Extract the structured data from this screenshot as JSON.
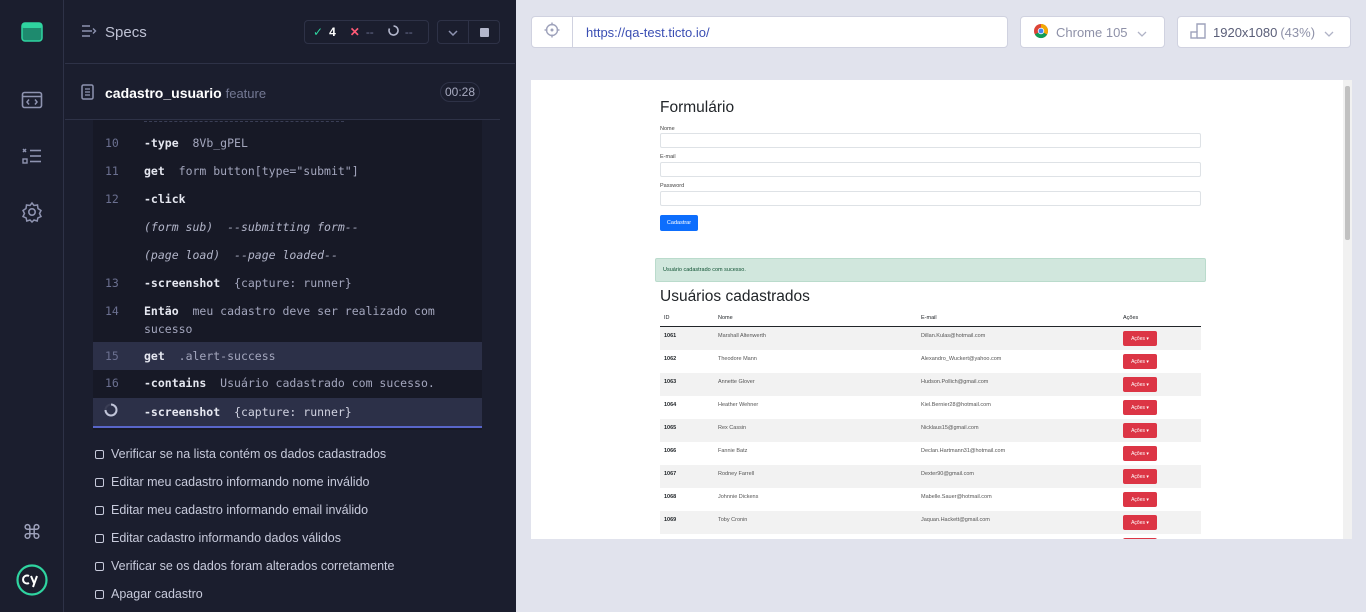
{
  "nav": {
    "icons": [
      "cypress-app-icon",
      "specs-icon",
      "runs-icon",
      "settings-icon",
      "keyboard-shortcuts-icon",
      "cypress-logo"
    ]
  },
  "reporter": {
    "specs_label": "Specs",
    "stats": {
      "passed": "4",
      "failed": "--",
      "pending": "--"
    },
    "spec_name": "cadastro_usuario",
    "spec_ext": "feature",
    "timer": "00:28",
    "commands": [
      {
        "num": "10",
        "name": "-type",
        "msg": "8Vb_gPEL"
      },
      {
        "num": "11",
        "name": "get",
        "msg": "form button[type=\"submit\"]"
      },
      {
        "num": "12",
        "name": "-click",
        "msg": ""
      },
      {
        "num": "",
        "name": "(form sub)",
        "msg": "--submitting form--"
      },
      {
        "num": "",
        "name": "(page load)",
        "msg": "--page loaded--"
      },
      {
        "num": "13",
        "name": "-screenshot",
        "msg": "{capture: runner}"
      },
      {
        "num": "14",
        "name": "Então",
        "msg": "meu cadastro deve ser realizado com",
        "msg2": "sucesso"
      },
      {
        "num": "15",
        "name": "get",
        "msg": ".alert-success"
      },
      {
        "num": "16",
        "name": "-contains",
        "msg": "Usuário cadastrado com sucesso."
      },
      {
        "num": "",
        "name": "-screenshot",
        "msg": "{capture: runner}"
      }
    ],
    "tests": [
      "Verificar se na lista contém os dados cadastrados",
      "Editar meu cadastro informando nome inválido",
      "Editar meu cadastro informando email inválido",
      "Editar cadastro informando dados válidos",
      "Verificar se os dados foram alterados corretamente",
      "Apagar cadastro"
    ]
  },
  "aut": {
    "url": "https://qa-test.ticto.io/",
    "browser": "Chrome 105",
    "viewport": "1920x1080",
    "scale": "(43%)"
  },
  "app": {
    "form_title": "Formulário",
    "label_name": "Nome",
    "label_email": "E-mail",
    "label_password": "Password",
    "submit_label": "Cadastrar",
    "alert": "Usuário cadastrado com sucesso.",
    "table_title": "Usuários cadastrados",
    "columns": [
      "ID",
      "Nome",
      "E-mail",
      "Ações"
    ],
    "action_label": "Ações",
    "rows": [
      {
        "id": "1061",
        "name": "Marshall Altenwerth",
        "email": "Dillan.Kulas@hotmail.com"
      },
      {
        "id": "1062",
        "name": "Theodore Mann",
        "email": "Alexandro_Wuckert@yahoo.com"
      },
      {
        "id": "1063",
        "name": "Annette Glover",
        "email": "Hudson.Pollich@gmail.com"
      },
      {
        "id": "1064",
        "name": "Heather Wehner",
        "email": "Kiel.Bernier28@hotmail.com"
      },
      {
        "id": "1065",
        "name": "Rex Cassin",
        "email": "Nicklaus15@gmail.com"
      },
      {
        "id": "1066",
        "name": "Fannie Batz",
        "email": "Declan.Hartmann31@hotmail.com"
      },
      {
        "id": "1067",
        "name": "Rodney Farrell",
        "email": "Dexter90@gmail.com"
      },
      {
        "id": "1068",
        "name": "Johnnie Dickens",
        "email": "Mabelle.Sauer@hotmail.com"
      },
      {
        "id": "1069",
        "name": "Toby Cronin",
        "email": "Jaquan.Hackett@gmail.com"
      }
    ]
  }
}
